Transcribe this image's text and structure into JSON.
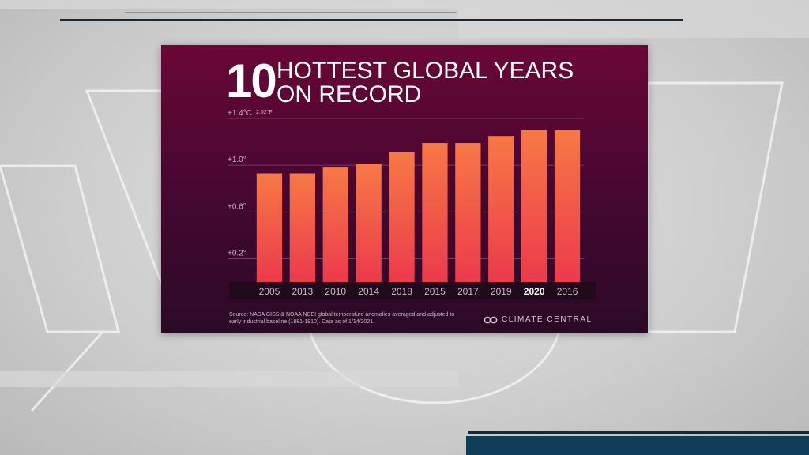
{
  "chart_data": {
    "type": "bar",
    "title_number": "10",
    "title_line1": "HOTTEST GLOBAL YEARS",
    "title_line2": "ON RECORD",
    "categories": [
      "2005",
      "2013",
      "2010",
      "2014",
      "2018",
      "2015",
      "2017",
      "2019",
      "2020",
      "2016"
    ],
    "values": [
      0.93,
      0.93,
      0.98,
      1.01,
      1.11,
      1.19,
      1.19,
      1.25,
      1.3,
      1.3
    ],
    "highlight_category": "2020",
    "y_ticks": [
      {
        "value": 0.2,
        "label": "+0.2°"
      },
      {
        "value": 0.6,
        "label": "+0.6°"
      },
      {
        "value": 1.0,
        "label": "+1.0°"
      },
      {
        "value": 1.4,
        "label": "+1.4°C"
      }
    ],
    "y_top_secondary_label": "2.52°F",
    "ylim": [
      0,
      1.4
    ],
    "grid": true,
    "bar_color_top": "#f77845",
    "bar_color_bottom": "#ec3a4c",
    "source": "Source: NASA GISS & NOAA NCEI global temperature anomalies averaged and adjusted to early industrial baseline (1881-1910). Data as of 1/14/2021.",
    "brand": "CLIMATE CENTRAL"
  }
}
